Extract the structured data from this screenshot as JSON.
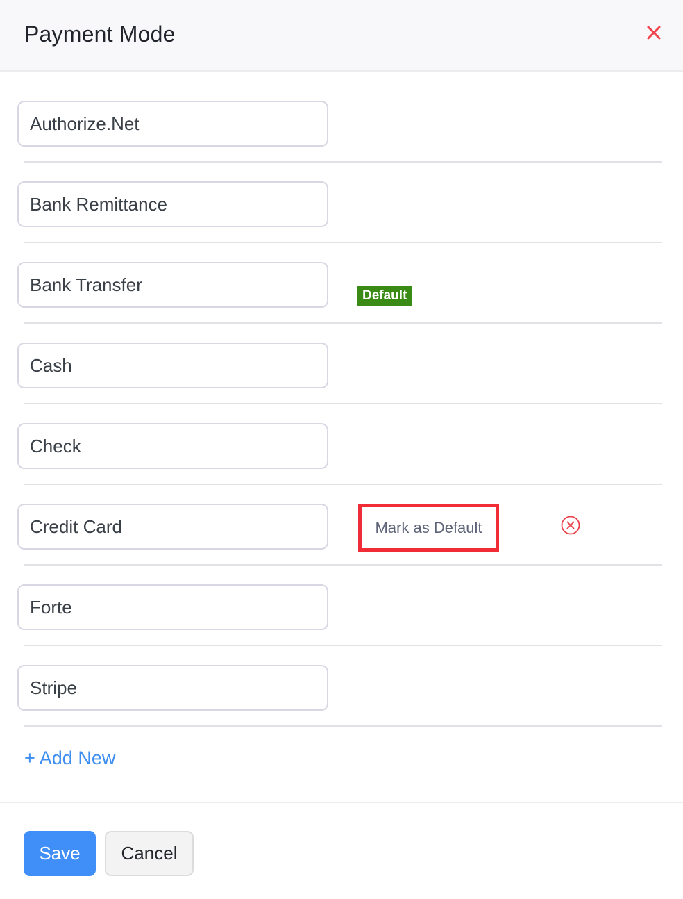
{
  "header": {
    "title": "Payment Mode",
    "close_icon": "close-icon"
  },
  "payment_modes": [
    {
      "name": "Authorize.Net"
    },
    {
      "name": "Bank Remittance"
    },
    {
      "name": "Bank Transfer"
    },
    {
      "name": "Cash",
      "is_default": true
    },
    {
      "name": "Check"
    },
    {
      "name": "Credit Card",
      "hovered": true
    },
    {
      "name": "Forte"
    },
    {
      "name": "Stripe"
    }
  ],
  "row_actions": {
    "default_badge": "Default",
    "mark_as_default": "Mark as Default",
    "remove_icon": "remove-circle-x-icon"
  },
  "add_new_label": "+ Add New",
  "footer": {
    "save_label": "Save",
    "cancel_label": "Cancel"
  },
  "colors": {
    "accent": "#408ef7",
    "link": "#3d8ef0",
    "default_badge": "#3a8a16",
    "danger": "#f02d37",
    "header_bg": "#f8f8fb"
  }
}
